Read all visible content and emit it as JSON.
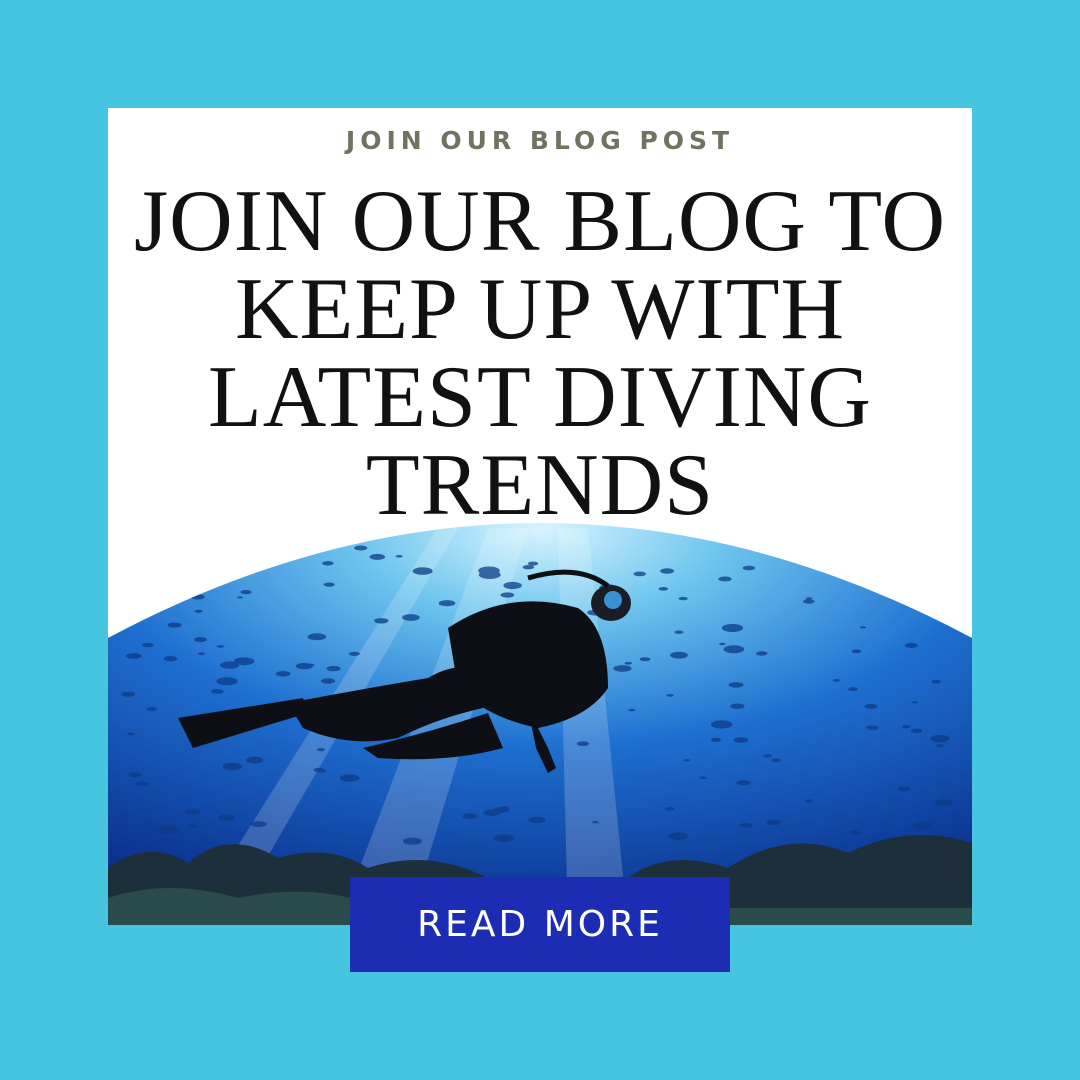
{
  "eyebrow": "JOIN OUR BLOG POST",
  "headline": {
    "lines": [
      "JOIN OUR BLOG TO",
      "KEEP UP WITH",
      "LATEST DIVING",
      "TRENDS"
    ]
  },
  "photo": {
    "subject": "scuba diver swimming among a school of fish over a coral reef"
  },
  "cta": {
    "label": "READ MORE"
  },
  "colors": {
    "background": "#45c5df",
    "card": "#ffffff",
    "eyebrow": "#6e7460",
    "headline": "#111111",
    "cta": "#1c2db4",
    "water_light": "#7fd3f2",
    "water_deep": "#0a2f8c"
  }
}
